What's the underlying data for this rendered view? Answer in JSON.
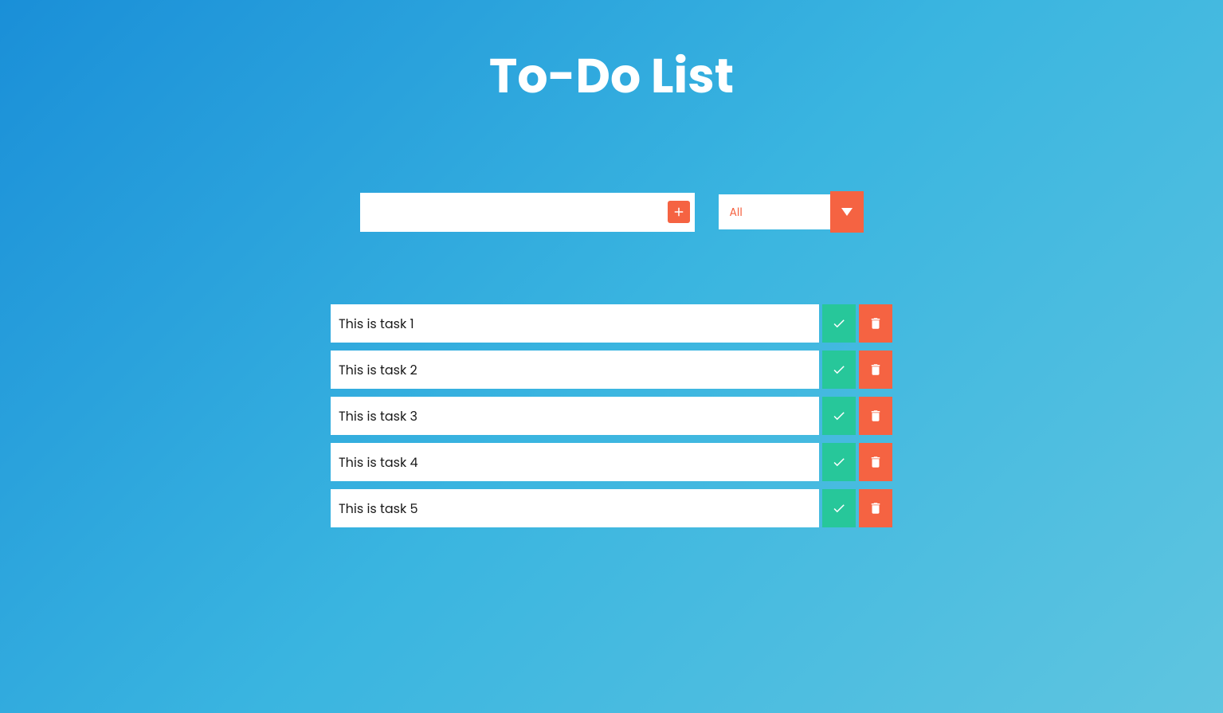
{
  "header": {
    "title": "To-Do List"
  },
  "input": {
    "value": "",
    "placeholder": ""
  },
  "filter": {
    "selected": "All"
  },
  "tasks": [
    {
      "text": "This is task 1"
    },
    {
      "text": "This is task 2"
    },
    {
      "text": "This is task 3"
    },
    {
      "text": "This is task 4"
    },
    {
      "text": "This is task 5"
    }
  ]
}
